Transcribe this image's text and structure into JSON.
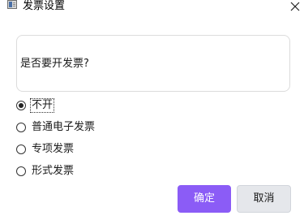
{
  "window": {
    "title": "发票设置",
    "icon": "app-window-icon",
    "close_icon": "close-icon"
  },
  "question": {
    "text": "是否要开发票?"
  },
  "options": [
    {
      "label": "不开",
      "checked": true,
      "focused": true
    },
    {
      "label": "普通电子发票",
      "checked": false
    },
    {
      "label": "专项发票",
      "checked": false
    },
    {
      "label": "形式发票",
      "checked": false
    }
  ],
  "buttons": {
    "confirm_label": "确定",
    "cancel_label": "取消"
  },
  "colors": {
    "primary": "#8b5cf6",
    "secondary": "#e5e7eb",
    "border": "#dcdcdc"
  }
}
